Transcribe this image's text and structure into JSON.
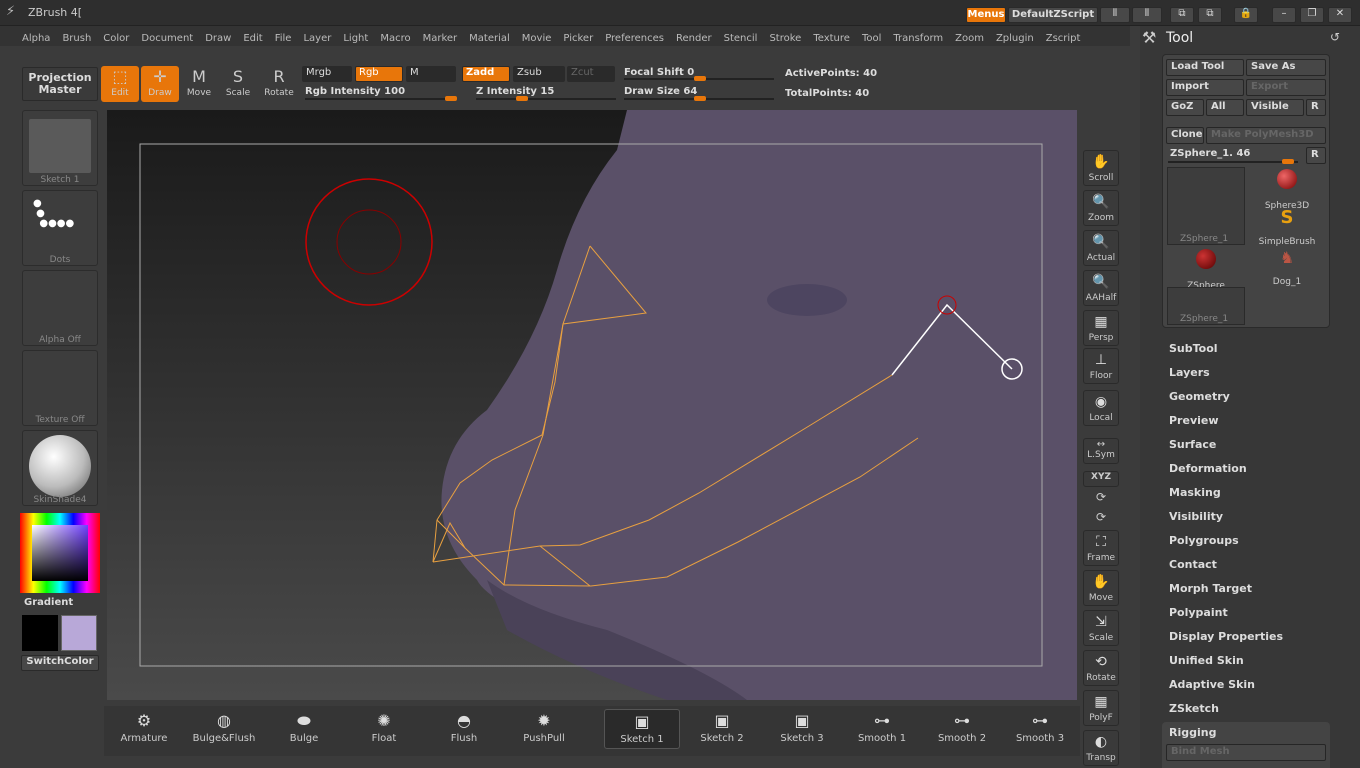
{
  "title": "ZBrush 4[",
  "topright": {
    "menus": "Menus",
    "script": "DefaultZScript"
  },
  "menu": [
    "Alpha",
    "Brush",
    "Color",
    "Document",
    "Draw",
    "Edit",
    "File",
    "Layer",
    "Light",
    "Macro",
    "Marker",
    "Material",
    "Movie",
    "Picker",
    "Preferences",
    "Render",
    "Stencil",
    "Stroke",
    "Texture",
    "Tool",
    "Transform",
    "Zoom",
    "Zplugin",
    "Zscript"
  ],
  "projection_master": "Projection Master",
  "tools": {
    "edit": "Edit",
    "draw": "Draw",
    "move": "Move",
    "scale": "Scale",
    "rotate": "Rotate"
  },
  "shelf": {
    "mrgb": "Mrgb",
    "rgb": "Rgb",
    "m": "M",
    "zadd": "Zadd",
    "zsub": "Zsub",
    "zcut": "Zcut",
    "rgb_intensity": "Rgb Intensity 100",
    "z_intensity": "Z Intensity 15",
    "focal_shift": "Focal Shift 0",
    "draw_size": "Draw Size 64",
    "active_points": "ActivePoints: 40",
    "total_points": "TotalPoints: 40"
  },
  "left": {
    "sketch": "Sketch 1",
    "dots": "Dots",
    "alpha": "Alpha Off",
    "texture": "Texture Off",
    "material": "SkinShade4",
    "gradient": "Gradient",
    "switch": "SwitchColor"
  },
  "right_shelf": [
    "Scroll",
    "Zoom",
    "Actual",
    "AAHalf",
    "Persp",
    "Floor",
    "Local",
    "L.Sym",
    "XYZ",
    "Frame",
    "Move",
    "Scale",
    "Rotate",
    "PolyF",
    "Transp"
  ],
  "bottom_brushes": [
    "Armature",
    "Bulge&Flush",
    "Bulge",
    "Float",
    "Flush",
    "PushPull",
    "Sketch 1",
    "Sketch 2",
    "Sketch 3",
    "Smooth 1",
    "Smooth 2",
    "Smooth 3"
  ],
  "tool_panel": {
    "title": "Tool",
    "load": "Load Tool",
    "save": "Save As",
    "import": "Import",
    "export": "Export",
    "goz": "GoZ",
    "all": "All",
    "visible": "Visible",
    "r": "R",
    "clone": "Clone",
    "make_polymesh": "Make PolyMesh3D",
    "current": "ZSphere_1. 46",
    "items": [
      "ZSphere_1",
      "Sphere3D",
      "SimpleBrush",
      "ZSphere",
      "Dog_1",
      "ZSphere_1"
    ],
    "sections": [
      "SubTool",
      "Layers",
      "Geometry",
      "Preview",
      "Surface",
      "Deformation",
      "Masking",
      "Visibility",
      "Polygroups",
      "Contact",
      "Morph Target",
      "Polypaint",
      "Display Properties",
      "Unified Skin",
      "Adaptive Skin",
      "ZSketch"
    ],
    "rigging": "Rigging",
    "bind_mesh": "Bind Mesh"
  },
  "colors": {
    "accent": "#e8760a",
    "swatch_main": "#000000",
    "swatch_alt": "#b8a8d8",
    "mesh": "#5a5068"
  }
}
